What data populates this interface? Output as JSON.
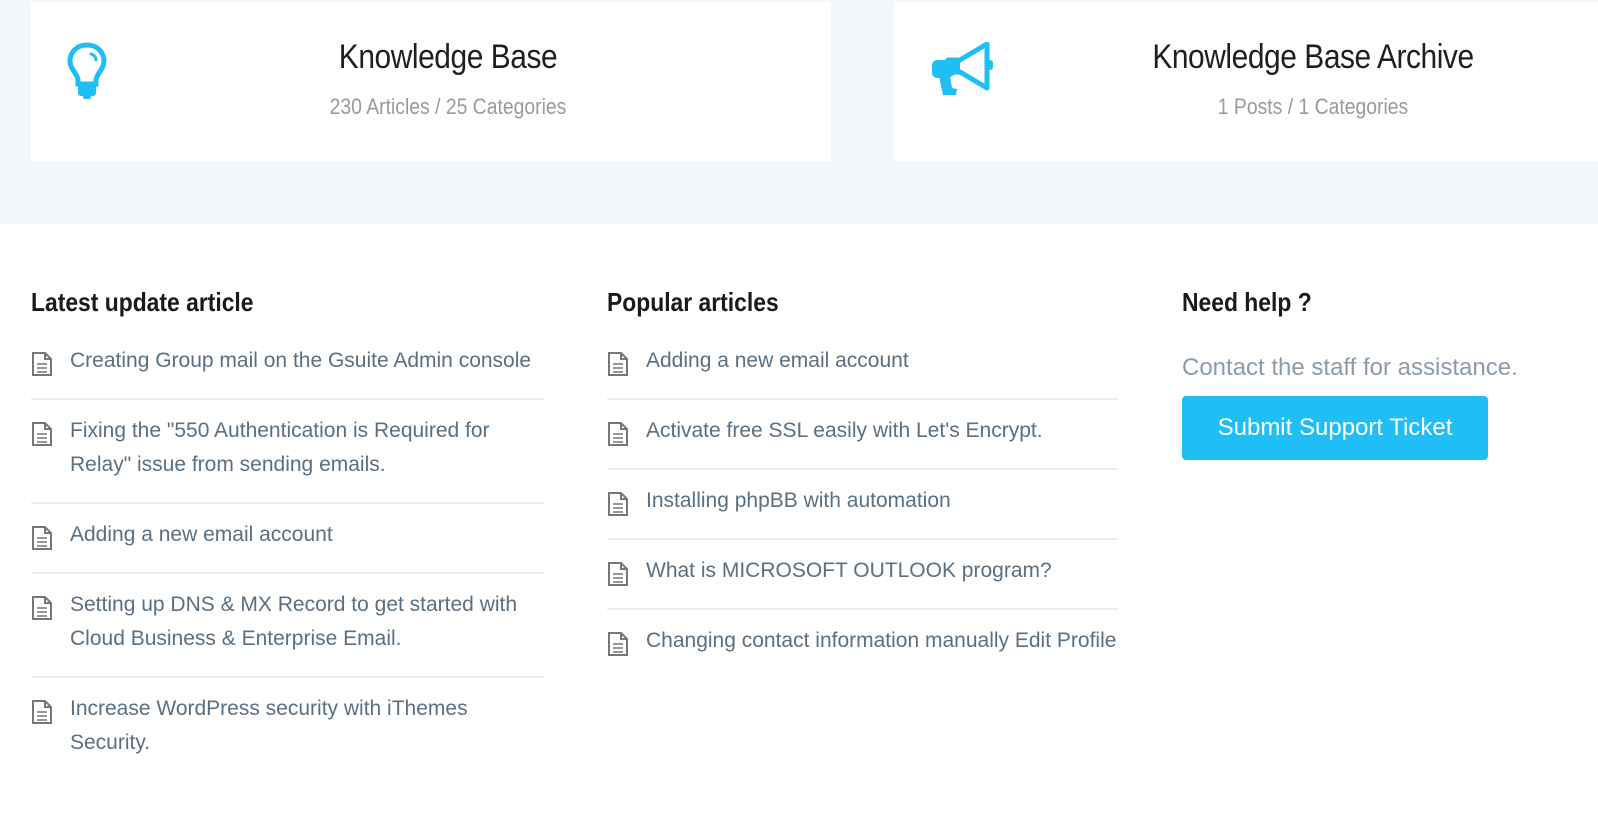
{
  "theme": {
    "accent": "#1fbff6",
    "link": "#5a6f82",
    "muted": "#9a9a9a",
    "band": "#f4f7fa"
  },
  "cards": [
    {
      "icon": "lightbulb-icon",
      "title": "Knowledge Base",
      "subtitle": "230 Articles / 25 Categories"
    },
    {
      "icon": "megaphone-icon",
      "title": "Knowledge Base Archive",
      "subtitle": "1 Posts / 1 Categories"
    }
  ],
  "latest": {
    "title": "Latest update article",
    "items": [
      "Creating Group mail on the Gsuite Admin console",
      "Fixing the \"550 Authentication is Required for Relay\" issue from sending emails.",
      "Adding a new email account",
      "Setting up DNS & MX Record to get started with Cloud Business & Enterprise Email.",
      "Increase WordPress security with iThemes Security."
    ]
  },
  "popular": {
    "title": "Popular articles",
    "items": [
      "Adding a new email account",
      "Activate free SSL easily with Let's Encrypt.",
      "Installing phpBB with automation",
      "What is MICROSOFT OUTLOOK program?",
      "Changing contact information manually Edit Profile"
    ]
  },
  "help": {
    "title": "Need help ?",
    "text": "Contact the staff for assistance.",
    "button": "Submit Support Ticket"
  }
}
